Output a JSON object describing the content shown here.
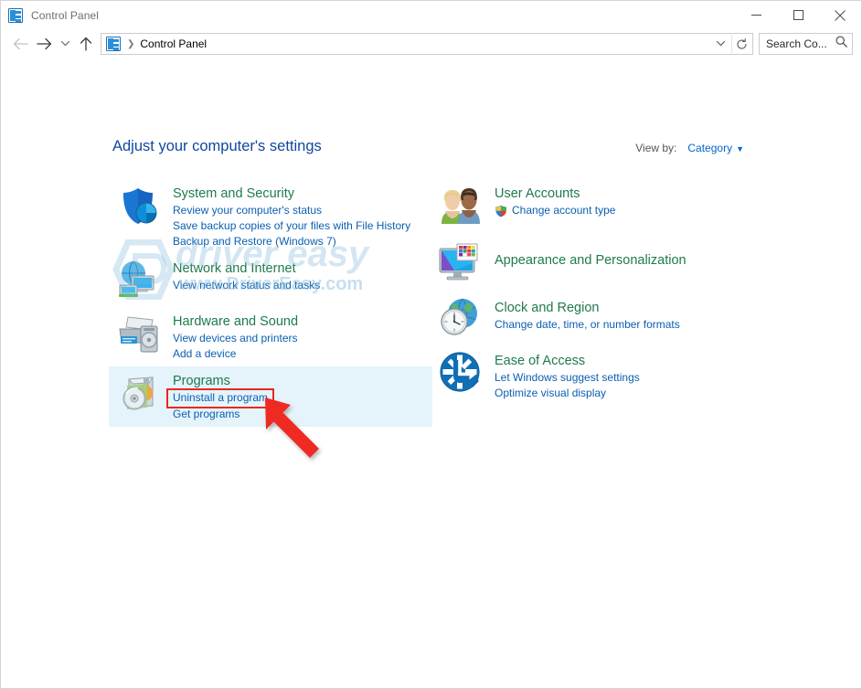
{
  "window": {
    "title": "Control Panel",
    "title_icon": "control-panel-icon",
    "controls": [
      {
        "name": "minimize-button",
        "glyph": "minimize"
      },
      {
        "name": "maximize-button",
        "glyph": "maximize"
      },
      {
        "name": "close-button",
        "glyph": "close"
      }
    ]
  },
  "navbar": {
    "back": "←",
    "forward": "→",
    "recent_caret": "⌄",
    "up": "↑",
    "address": {
      "icon": "control-panel-icon",
      "separator": "❯",
      "crumb": "Control Panel",
      "dropdown_caret": "⌄",
      "refresh_glyph": "↻"
    },
    "search": {
      "placeholder": "Search Co...",
      "icon": "search-icon"
    }
  },
  "content": {
    "page_title": "Adjust your computer's settings",
    "view_by": {
      "label": "View by:",
      "value": "Category",
      "caret": "▼"
    },
    "left_column": [
      {
        "icon": "shield-icon",
        "title": "System and Security",
        "links": [
          {
            "text": "Review your computer's status"
          },
          {
            "text": "Save backup copies of your files with File History"
          },
          {
            "text": "Backup and Restore (Windows 7)"
          }
        ],
        "highlighted": false
      },
      {
        "icon": "network-icon",
        "title": "Network and Internet",
        "links": [
          {
            "text": "View network status and tasks"
          }
        ],
        "highlighted": false
      },
      {
        "icon": "printer-icon",
        "title": "Hardware and Sound",
        "links": [
          {
            "text": "View devices and printers"
          },
          {
            "text": "Add a device"
          }
        ],
        "highlighted": false
      },
      {
        "icon": "programs-disc-icon",
        "title": "Programs",
        "links": [
          {
            "text": "Uninstall a program",
            "boxed": true
          },
          {
            "text": "Get programs"
          }
        ],
        "highlighted": true
      }
    ],
    "right_column": [
      {
        "icon": "user-accounts-icon",
        "title": "User Accounts",
        "links": [
          {
            "text": "Change account type",
            "shield": true
          }
        ]
      },
      {
        "icon": "appearance-monitor-icon",
        "title": "Appearance and Personalization",
        "links": []
      },
      {
        "icon": "clock-globe-icon",
        "title": "Clock and Region",
        "links": [
          {
            "text": "Change date, time, or number formats"
          }
        ]
      },
      {
        "icon": "ease-of-access-icon",
        "title": "Ease of Access",
        "links": [
          {
            "text": "Let Windows suggest settings"
          },
          {
            "text": "Optimize visual display"
          }
        ]
      }
    ]
  },
  "annotations": {
    "watermark": {
      "text": "driver easy",
      "subtext": "www.DriverEasy.com",
      "logo": "hexagon-logo"
    },
    "highlight_box": {
      "name": "red-highlight-box",
      "color": "#e8291f",
      "target": "Uninstall a program"
    },
    "arrow": {
      "name": "red-arrow-annotation",
      "color": "#ef2a22",
      "direction": "up-left"
    }
  },
  "colors": {
    "category_title": "#1f7a4d",
    "link": "#0a5fb0",
    "page_title": "#10479e",
    "highlight_row": "#e5f3fb",
    "annotation_red": "#e8291f"
  }
}
